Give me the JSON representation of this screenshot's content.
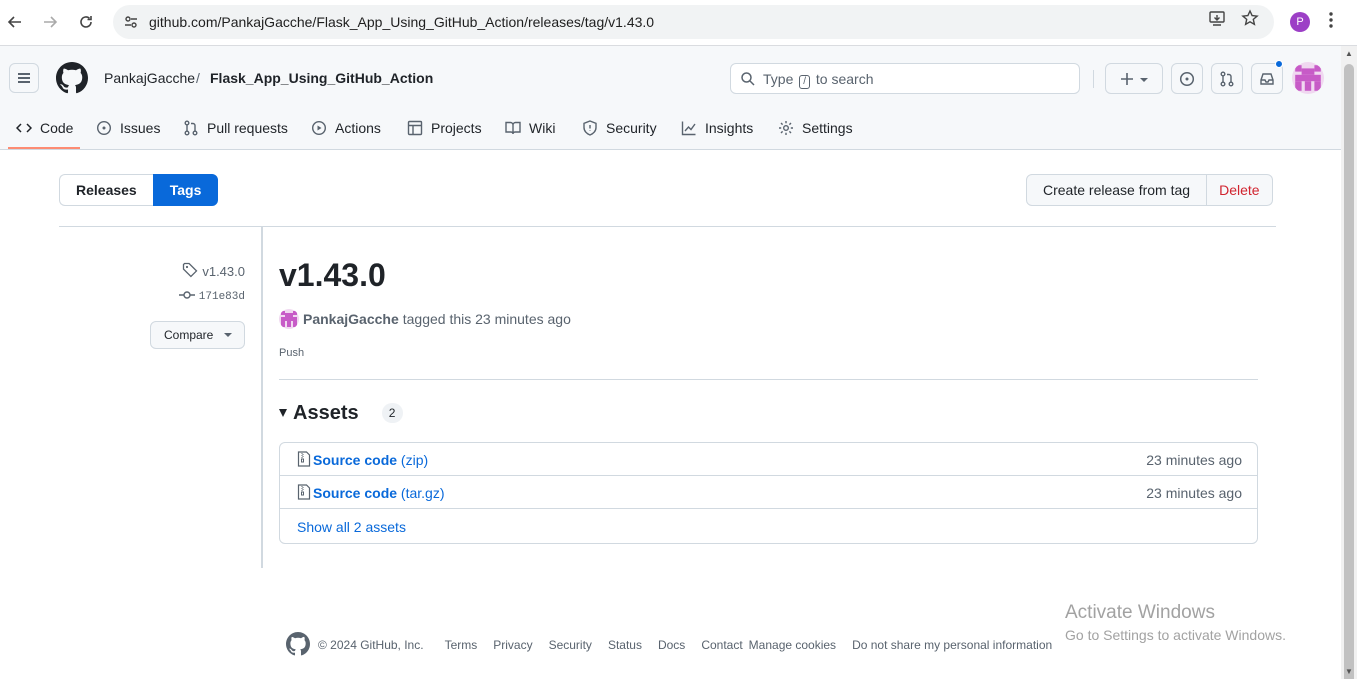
{
  "browser": {
    "url": "github.com/PankajGacche/Flask_App_Using_GitHub_Action/releases/tag/v1.43.0",
    "profile_initial": "P"
  },
  "header": {
    "owner": "PankajGacche",
    "separator": "/",
    "repo": "Flask_App_Using_GitHub_Action",
    "search_pre": "Type",
    "search_key": "/",
    "search_post": "to search"
  },
  "repo_nav": [
    {
      "label": "Code",
      "icon": "code-icon"
    },
    {
      "label": "Issues",
      "icon": "issue-icon"
    },
    {
      "label": "Pull requests",
      "icon": "pull-request-icon"
    },
    {
      "label": "Actions",
      "icon": "play-icon"
    },
    {
      "label": "Projects",
      "icon": "table-icon"
    },
    {
      "label": "Wiki",
      "icon": "book-icon"
    },
    {
      "label": "Security",
      "icon": "shield-icon"
    },
    {
      "label": "Insights",
      "icon": "graph-icon"
    },
    {
      "label": "Settings",
      "icon": "gear-icon"
    }
  ],
  "subnav": {
    "releases": "Releases",
    "tags": "Tags",
    "create": "Create release from tag",
    "delete": "Delete"
  },
  "sidebar": {
    "tag": "v1.43.0",
    "commit": "171e83d",
    "compare": "Compare"
  },
  "release": {
    "title": "v1.43.0",
    "author": "PankajGacche",
    "tagged_text": "tagged this 23 minutes ago",
    "body": "Push"
  },
  "assets": {
    "label": "Assets",
    "count": "2",
    "items": [
      {
        "name": "Source code",
        "ext": "(zip)",
        "when": "23 minutes ago"
      },
      {
        "name": "Source code",
        "ext": "(tar.gz)",
        "when": "23 minutes ago"
      }
    ],
    "show_all": "Show all 2 assets"
  },
  "footer": {
    "copyright": "© 2024 GitHub, Inc.",
    "links": [
      "Terms",
      "Privacy",
      "Security",
      "Status",
      "Docs",
      "Contact",
      "Manage cookies",
      "Do not share my personal information"
    ]
  },
  "watermark": {
    "line1": "Activate Windows",
    "line2": "Go to Settings to activate Windows."
  },
  "colors": {
    "accent": "#0969da",
    "danger": "#d1242f",
    "underline": "#fd8c73"
  }
}
